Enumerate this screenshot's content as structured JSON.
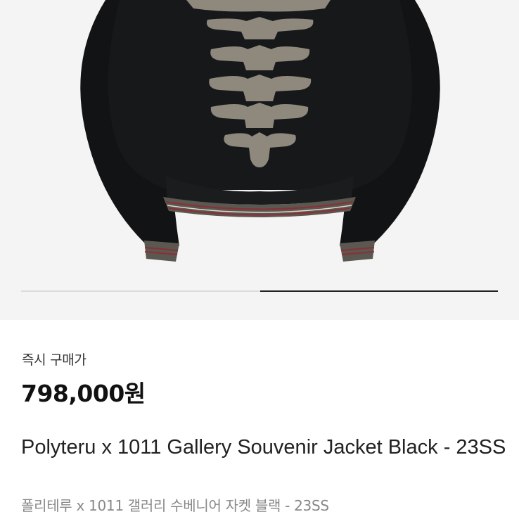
{
  "product": {
    "image_alt": "product-photo-jacket-back",
    "gallery": {
      "total_slides": 2,
      "active_slide": 2
    },
    "buy_label": "즉시 구매가",
    "price": "798,000원",
    "title": "Polyteru x 1011 Gallery Souvenir Jacket Black - 23SS",
    "subtitle": "폴리테루 x 1011 갤러리 수베니어 자켓 블랙 - 23SS"
  },
  "colors": {
    "image_background": "#f4f4f4",
    "jacket": "#141516",
    "print": "#8e887d",
    "rib_gray": "#58564f",
    "rib_red": "#8c2f35",
    "indicator_active": "#222222",
    "indicator_track": "#dcdcdc"
  }
}
